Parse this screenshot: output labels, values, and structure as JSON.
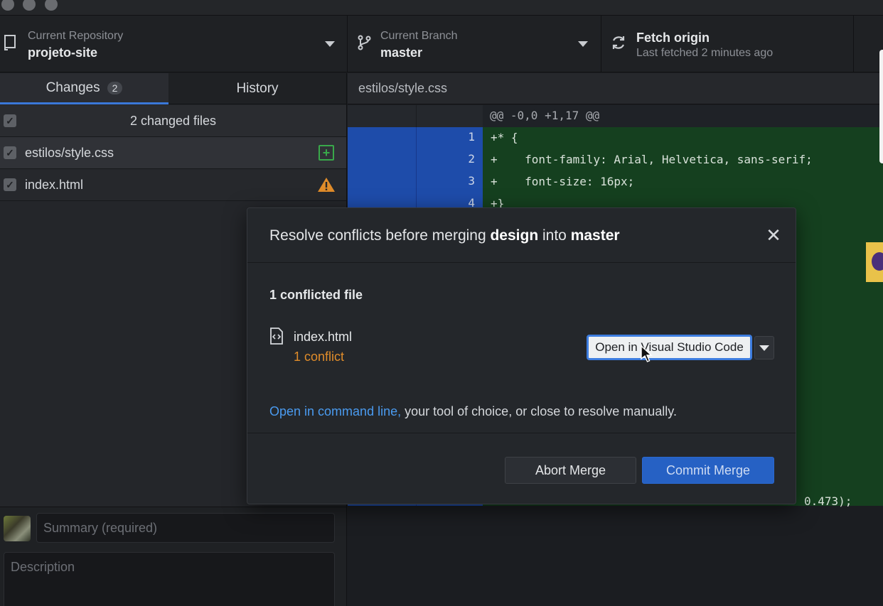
{
  "toolbar": {
    "repo_caption": "Current Repository",
    "repo_name": "projeto-site",
    "branch_caption": "Current Branch",
    "branch_name": "master",
    "fetch_title": "Fetch origin",
    "fetch_subtitle": "Last fetched 2 minutes ago"
  },
  "sidebar": {
    "tabs": [
      {
        "label": "Changes",
        "count": "2"
      },
      {
        "label": "History"
      }
    ],
    "changed_files_header": "2 changed files",
    "files": [
      {
        "name": "estilos/style.css",
        "status_icon": "added-icon"
      },
      {
        "name": "index.html",
        "status_icon": "warning-icon"
      }
    ],
    "summary_placeholder": "Summary (required)",
    "description_placeholder": "Description"
  },
  "diff": {
    "file_path": "estilos/style.css",
    "hunk_header": "@@ -0,0 +1,17 @@",
    "lines": [
      {
        "num": "1",
        "text": "+* {"
      },
      {
        "num": "2",
        "text": "+    font-family: Arial, Helvetica, sans-serif;"
      },
      {
        "num": "3",
        "text": "+    font-size: 16px;"
      },
      {
        "num": "4",
        "text": "+}"
      }
    ],
    "partial_line": "0.473);"
  },
  "modal": {
    "title_prefix": "Resolve conflicts before merging ",
    "source_branch": "design",
    "title_middle": " into ",
    "target_branch": "master",
    "conflicted_header": "1 conflicted file",
    "conflicted_file": "index.html",
    "conflict_count": "1 conflict",
    "open_editor_label": "Open in Visual Studio Code",
    "hint_link": "Open in command line,",
    "hint_rest": " your tool of choice, or close to resolve manually.",
    "abort_label": "Abort Merge",
    "commit_label": "Commit Merge"
  },
  "colors": {
    "accent": "#2661c4",
    "conflict": "#e08c2a",
    "added": "#39a84a",
    "link": "#4a9bf0"
  }
}
